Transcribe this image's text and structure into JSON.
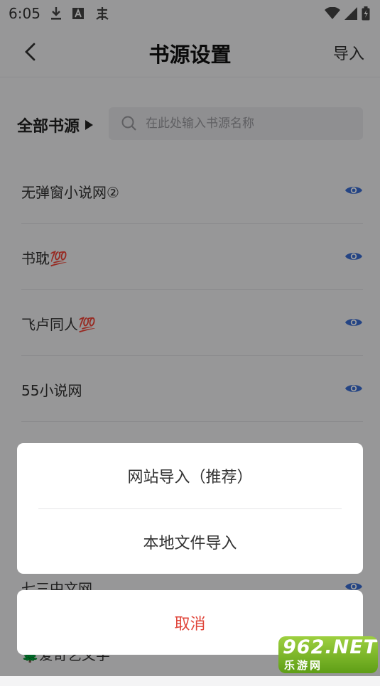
{
  "status_bar": {
    "time": "6:05",
    "icons": [
      "download-icon",
      "font-a-icon",
      "bug-icon",
      "wifi-icon",
      "signal-icon",
      "battery-icon"
    ]
  },
  "header": {
    "title": "书源设置",
    "import_label": "导入"
  },
  "filter": {
    "label": "全部书源",
    "search_placeholder": "在此处输入书源名称"
  },
  "sources": [
    {
      "name": "无弹窗小说网②"
    },
    {
      "name": "书耽💯"
    },
    {
      "name": "飞卢同人💯"
    },
    {
      "name": "55小说网"
    },
    {
      "name": ""
    },
    {
      "name": ""
    },
    {
      "name": "七三中文网"
    },
    {
      "name": "🌲爱奇艺文学"
    }
  ],
  "import_sheet": {
    "options": [
      {
        "label": "网站导入（推荐）"
      },
      {
        "label": "本地文件导入"
      }
    ],
    "cancel_label": "取消"
  },
  "watermark": {
    "brand": "962.NET",
    "subtitle": "乐游网"
  },
  "colors": {
    "accent_blue": "#3b6fd6",
    "cancel_red": "#e0453a"
  }
}
